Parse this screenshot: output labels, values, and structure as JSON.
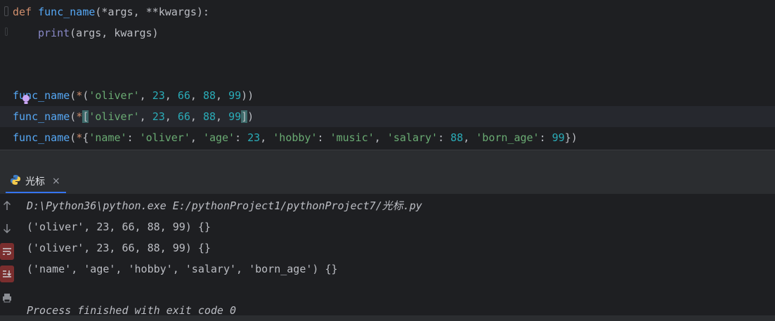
{
  "editor": {
    "line1": {
      "kw": "def",
      "name": "func_name",
      "args": "(*args, **kwargs):"
    },
    "line2": {
      "builtin": "print",
      "rest": "(args, kwargs)"
    },
    "call1": {
      "name": "func_name",
      "open": "(",
      "star": "*",
      "p1": "(",
      "s1": "'oliver'",
      "c1": ", ",
      "n1": "23",
      "c2": ", ",
      "n2": "66",
      "c3": ", ",
      "n3": "88",
      "c4": ", ",
      "n4": "99",
      "close": "))"
    },
    "call2": {
      "name": "func_name",
      "open": "(",
      "star": "*",
      "p1": "[",
      "s1": "'oliver'",
      "c1": ", ",
      "n1": "23",
      "c2": ", ",
      "n2": "66",
      "c3": ", ",
      "n3": "88",
      "c4": ", ",
      "n4": "99",
      "p2": "]",
      "close": ")"
    },
    "call3": {
      "name": "func_name",
      "open": "(",
      "star": "*",
      "p1": "{",
      "k1": "'name'",
      "col1": ": ",
      "v1": "'oliver'",
      "c1": ", ",
      "k2": "'age'",
      "col2": ": ",
      "v2": "23",
      "c2": ", ",
      "k3": "'hobby'",
      "col3": ": ",
      "v3": "'music'",
      "c3": ", ",
      "k4": "'salary'",
      "col4": ": ",
      "v4": "88",
      "c4": ", ",
      "k5": "'born_age'",
      "col5": ": ",
      "v5": "99",
      "p2": "}",
      "close": ")"
    }
  },
  "run_tab": {
    "label": "光标",
    "close": "×",
    "icon": "python-icon"
  },
  "console": {
    "command": "D:\\Python36\\python.exe E:/pythonProject1/pythonProject7/光标.py",
    "out1": "('oliver', 23, 66, 88, 99) {}",
    "out2": "('oliver', 23, 66, 88, 99) {}",
    "out3": "('name', 'age', 'hobby', 'salary', 'born_age') {}",
    "finish": "Process finished with exit code 0"
  },
  "colors": {
    "accent": "#3574f0",
    "keyword": "#cf8e6d",
    "function": "#56a8f5",
    "string": "#6aab73",
    "number": "#2aacb8"
  }
}
